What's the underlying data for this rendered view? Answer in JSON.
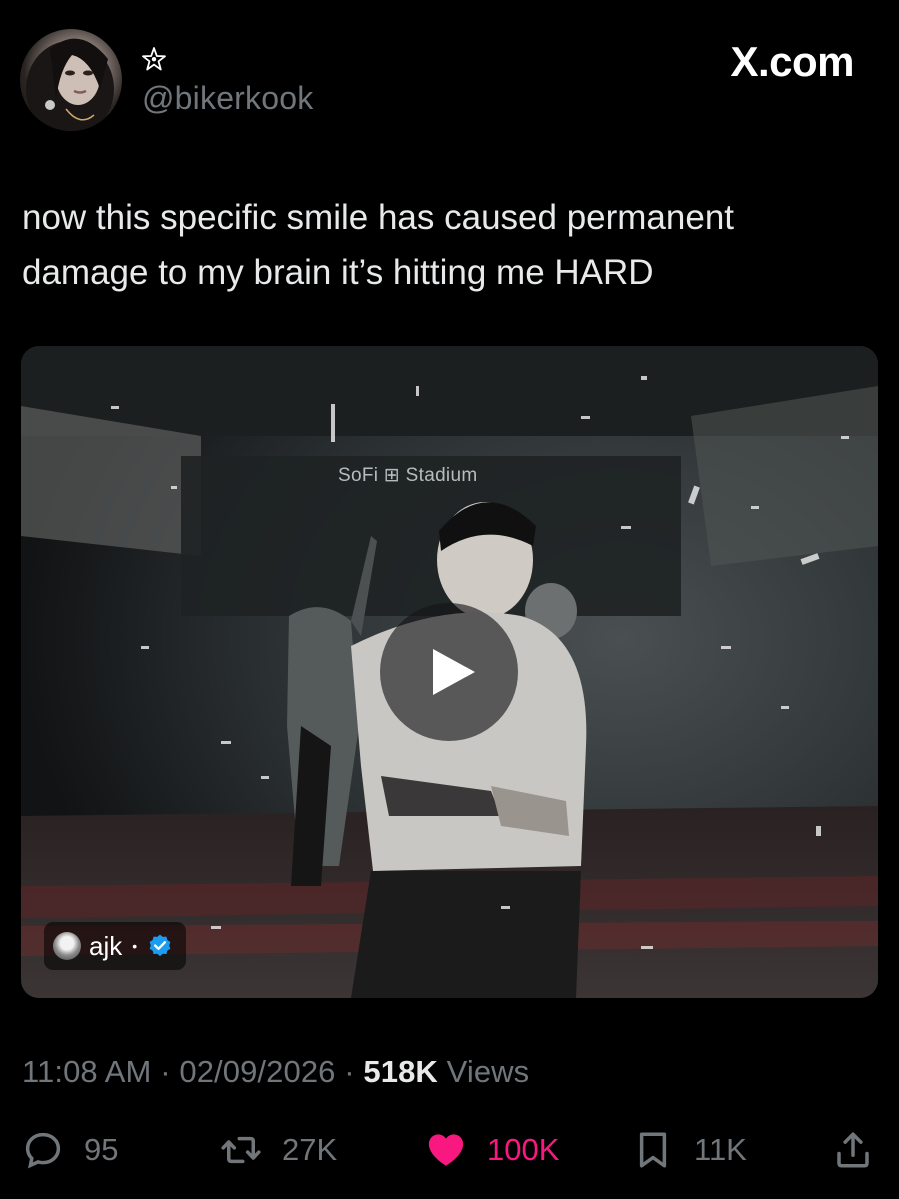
{
  "header": {
    "handle": "@bikerkook",
    "watermark": "X.com",
    "star_icon": "star-outline-icon",
    "avatar_icon": "profile-avatar"
  },
  "tweet": {
    "text": "now this specific smile has caused permanent\ndamage to my brain it’s hitting me HARD"
  },
  "media": {
    "type": "video",
    "sign_text": "SoFi ⊞ Stadium",
    "play_icon": "play-icon",
    "creator": {
      "name": "ajk",
      "separator": "•",
      "verified_icon": "verified-badge-icon",
      "verified_color": "#1d9bf0"
    }
  },
  "meta": {
    "time": "11:08 AM",
    "sep1": "·",
    "date": "02/09/2026",
    "sep2": "·",
    "views_count": "518K",
    "views_label": "Views"
  },
  "actions": {
    "replies": {
      "icon": "reply-icon",
      "count": "95"
    },
    "reposts": {
      "icon": "repost-icon",
      "count": "27K"
    },
    "likes": {
      "icon": "heart-filled-icon",
      "count": "100K",
      "liked": true,
      "color": "#f91880"
    },
    "bookmarks": {
      "icon": "bookmark-icon",
      "count": "11K"
    },
    "share": {
      "icon": "share-icon"
    }
  },
  "colors": {
    "background": "#000000",
    "text_primary": "#e7e9ea",
    "text_secondary": "#71767b",
    "like": "#f91880",
    "verified": "#1d9bf0"
  }
}
